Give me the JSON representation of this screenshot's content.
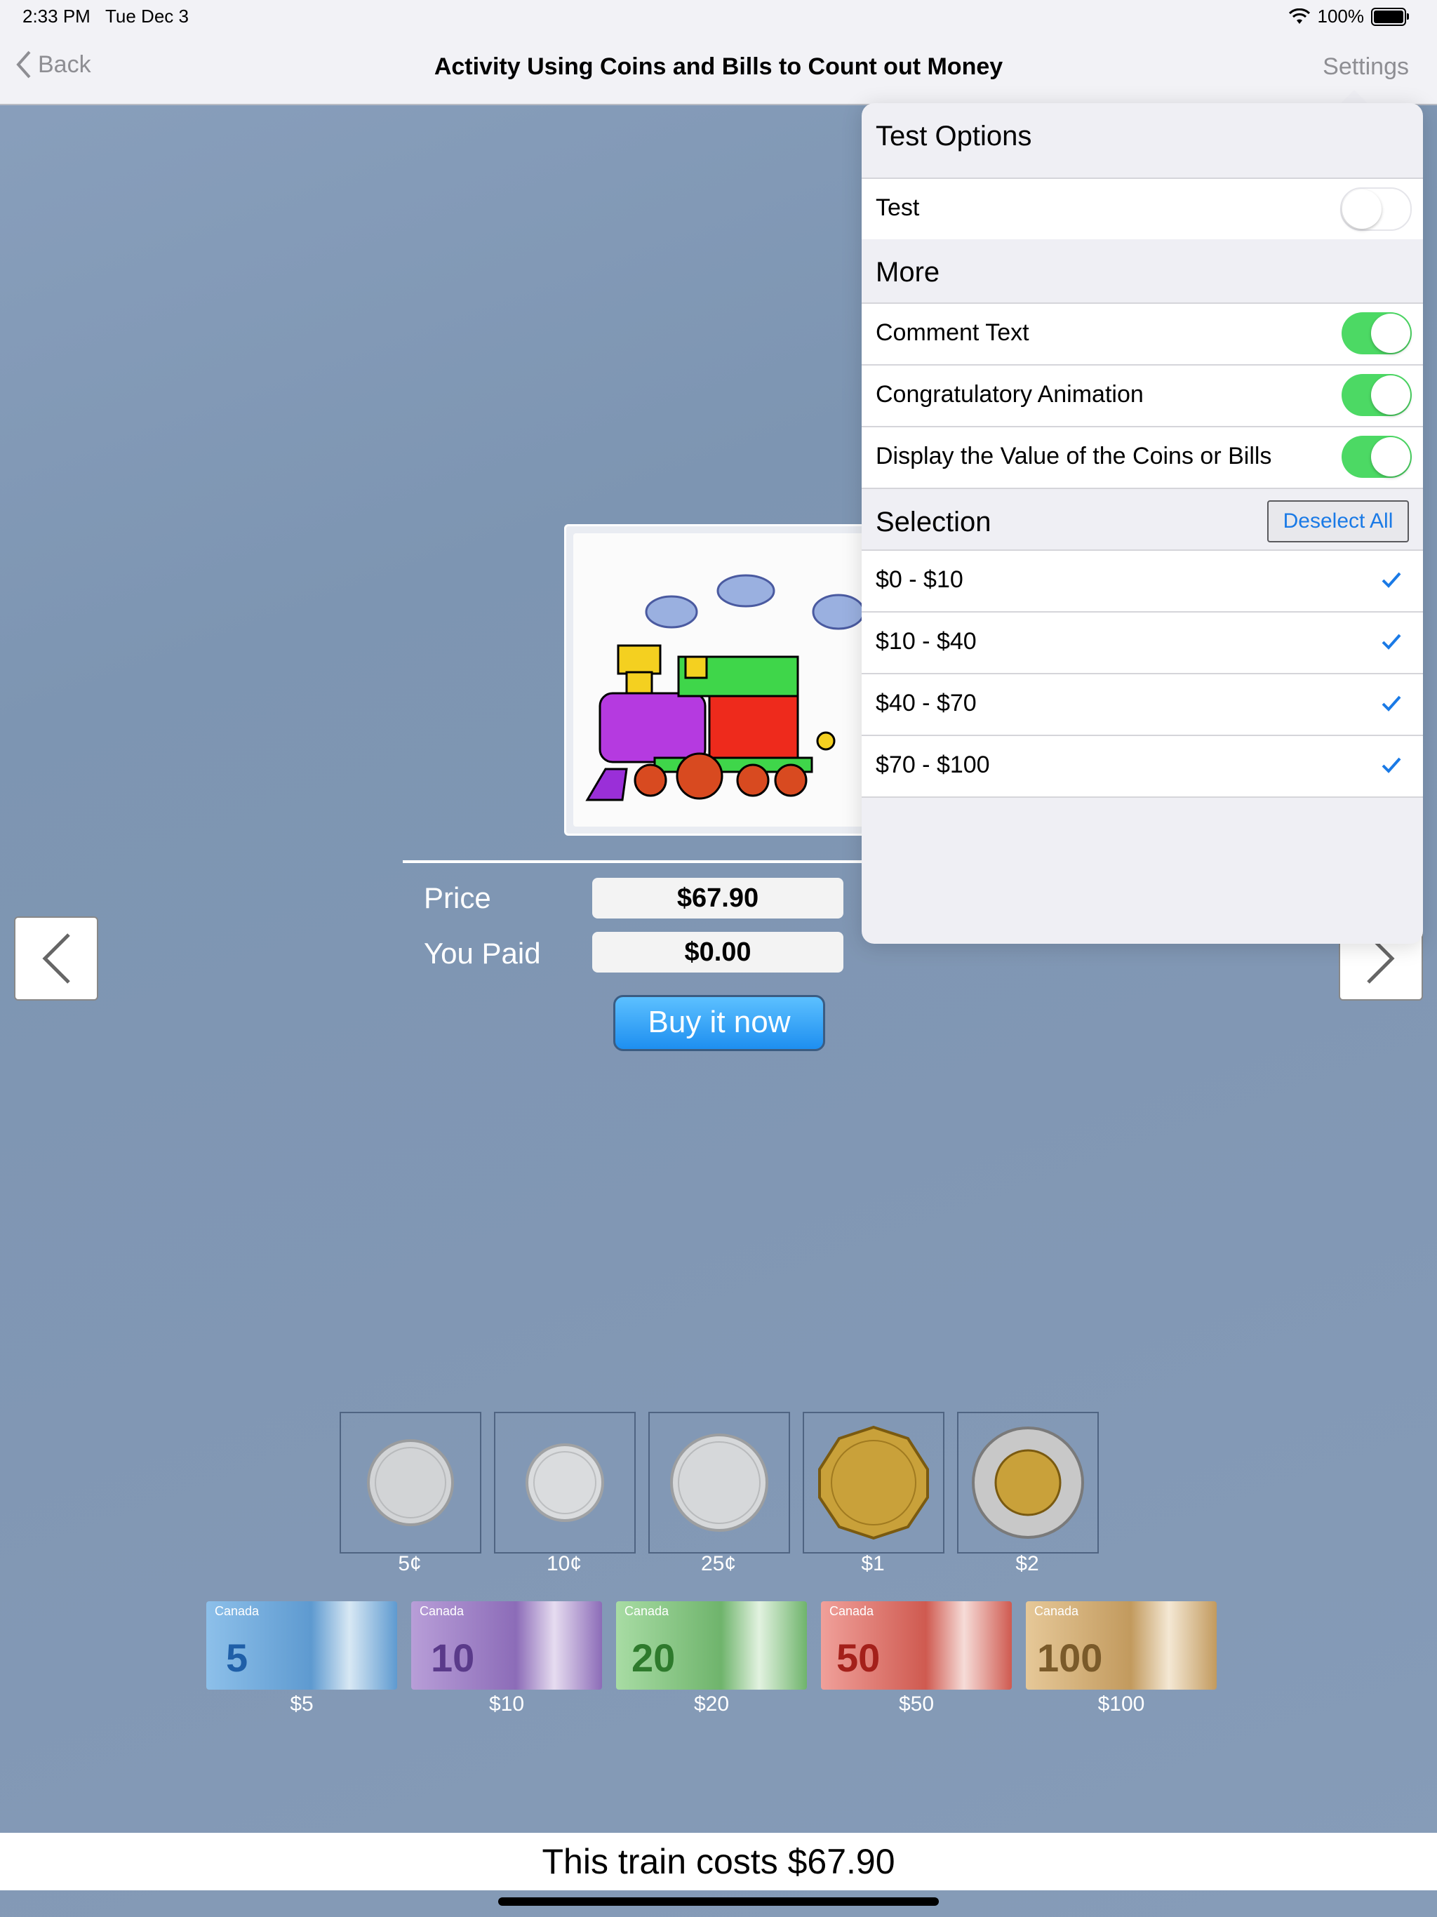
{
  "status": {
    "time": "2:33 PM",
    "date": "Tue Dec 3",
    "battery": "100%"
  },
  "nav": {
    "back": "Back",
    "title": "Activity Using Coins and Bills to Count out Money",
    "settings": "Settings"
  },
  "product": {
    "price_label": "Price",
    "price_value": "$67.90",
    "paid_label": "You Paid",
    "paid_value": "$0.00",
    "buy_label": "Buy it now"
  },
  "coins": [
    {
      "label": "5¢",
      "color": "#c9cbcd"
    },
    {
      "label": "10¢",
      "color": "#d6d8da"
    },
    {
      "label": "25¢",
      "color": "#d0d2d4"
    },
    {
      "label": "$1",
      "color": "#c8a03a"
    },
    {
      "label": "$2",
      "color": "#b8b8b8"
    }
  ],
  "bills": [
    {
      "label": "$5",
      "number": "5",
      "color": "#6fa6d8"
    },
    {
      "label": "$10",
      "number": "10",
      "color": "#9a7cc0"
    },
    {
      "label": "$20",
      "number": "20",
      "color": "#7bbf7a"
    },
    {
      "label": "$50",
      "number": "50",
      "color": "#d35a4e"
    },
    {
      "label": "$100",
      "number": "100",
      "color": "#c9a56c"
    }
  ],
  "bills_brand": "Canada",
  "footer": {
    "message": "This train costs $67.90"
  },
  "settings_popover": {
    "test_options_header": "Test Options",
    "test_label": "Test",
    "more_header": "More",
    "comment_text": "Comment Text",
    "congrats_animation": "Congratulatory Animation",
    "display_value": "Display the Value of the Coins or Bills",
    "selection_header": "Selection",
    "deselect_all": "Deselect All",
    "ranges": [
      "$0 - $10",
      "$10 - $40",
      "$40 - $70",
      "$70 - $100"
    ]
  },
  "colors": {
    "toggle_on": "#4cd964",
    "check_blue": "#1a7ae6",
    "buy_button": "#1e8ff0"
  }
}
